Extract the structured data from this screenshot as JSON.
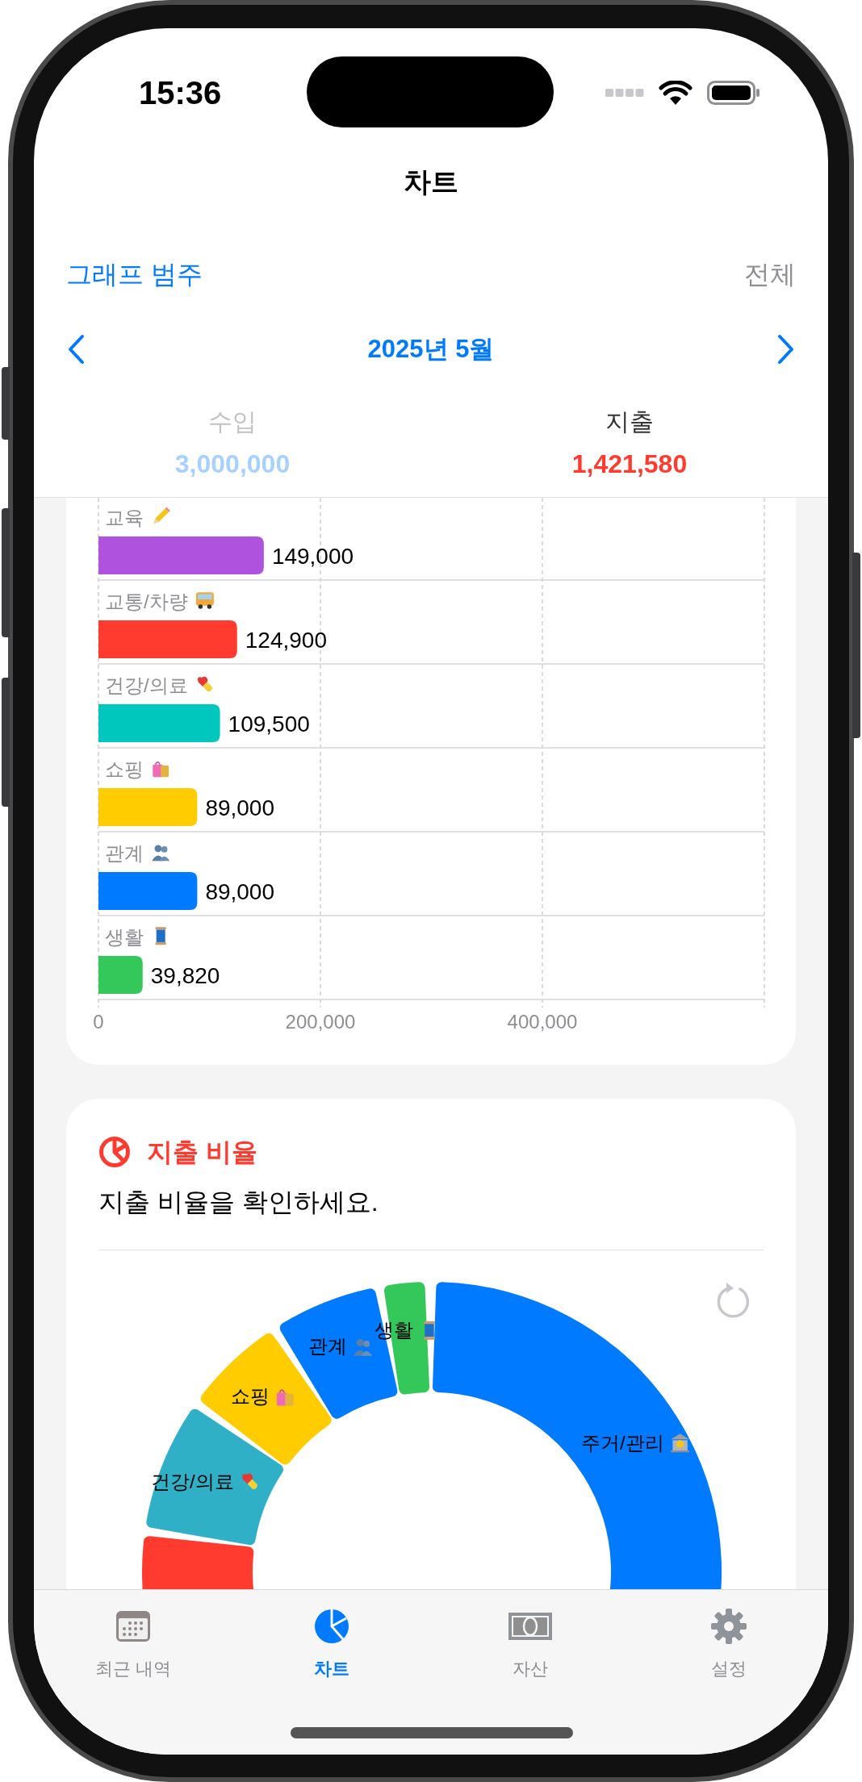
{
  "status_bar": {
    "time": "15:36"
  },
  "nav": {
    "title": "차트"
  },
  "toolbar": {
    "left": "그래프 범주",
    "right": "전체"
  },
  "period": {
    "label": "2025년 5월"
  },
  "summary": [
    {
      "label": "수입",
      "amount": "3,000,000",
      "kind": "income",
      "selected": false
    },
    {
      "label": "지출",
      "amount": "1,421,580",
      "kind": "expense",
      "selected": true
    }
  ],
  "bar_card": {
    "chart_data": {
      "type": "bar",
      "orientation": "horizontal",
      "categories": [
        "교육",
        "교통/차량",
        "건강/의료",
        "쇼핑",
        "관계",
        "생활"
      ],
      "values": [
        149000,
        124900,
        109500,
        89000,
        89000,
        39820
      ],
      "colors": [
        "#af52de",
        "#ff3b30",
        "#00c7be",
        "#ffcc00",
        "#007aff",
        "#34c759"
      ],
      "value_labels": [
        "149,000",
        "124,900",
        "109,500",
        "89,000",
        "89,000",
        "39,820"
      ],
      "xlim": [
        0,
        600000
      ],
      "xticks": [
        {
          "value": 0,
          "label": "0"
        },
        {
          "value": 200000,
          "label": "200,000"
        },
        {
          "value": 400000,
          "label": "400,000"
        }
      ]
    }
  },
  "ratio_card": {
    "title": "지출 비율",
    "subtitle": "지출 비율을 확인하세요.",
    "donut": {
      "segments": [
        {
          "label": "주거/관리",
          "color": "#007aff"
        },
        {
          "label": "생활",
          "color": "#34c759"
        },
        {
          "label": "관계",
          "color": "#007aff"
        },
        {
          "label": "쇼핑",
          "color": "#ffcc00"
        },
        {
          "label": "건강/의료",
          "color": "#30b0c7"
        },
        {
          "color": "#ff3b30"
        }
      ]
    }
  },
  "tab_bar": [
    {
      "label": "최근 내역",
      "selected": false
    },
    {
      "label": "차트",
      "selected": true
    },
    {
      "label": "자산",
      "selected": false
    },
    {
      "label": "설정",
      "selected": false
    }
  ]
}
